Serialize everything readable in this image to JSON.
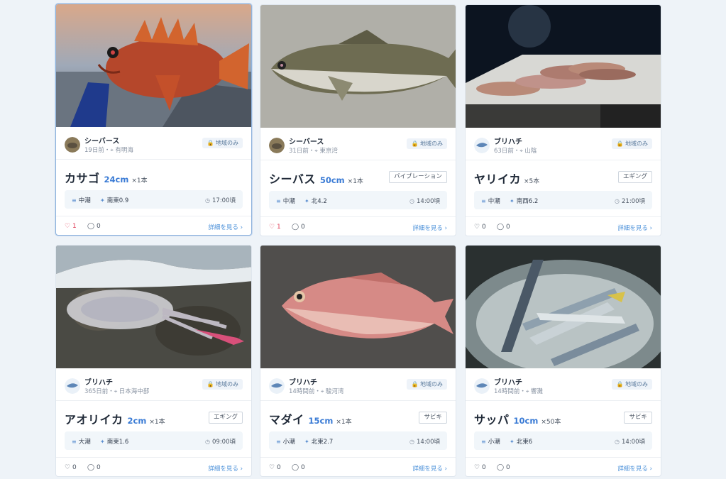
{
  "cards": [
    {
      "user": "シーバース",
      "meta": "19日前・",
      "location": "有明海",
      "badge": "地域のみ",
      "species": "カサゴ",
      "size": "24cm",
      "count": "×1本",
      "method": "",
      "tide": "中潮",
      "wind": "南東0.9",
      "time": "17:00頃",
      "likes": "1",
      "comments": "0",
      "detail": "詳細を見る ›",
      "photo_icon": "rockfish-photo"
    },
    {
      "user": "シーバース",
      "meta": "31日前・",
      "location": "東京湾",
      "badge": "地域のみ",
      "species": "シーバス",
      "size": "50cm",
      "count": "×1本",
      "method": "バイブレーション",
      "tide": "中潮",
      "wind": "北4.2",
      "time": "14:00頃",
      "likes": "1",
      "comments": "0",
      "detail": "詳細を見る ›",
      "photo_icon": "seabass-photo"
    },
    {
      "user": "ブリハチ",
      "meta": "63日前・",
      "location": "山陰",
      "badge": "地域のみ",
      "species": "ヤリイカ",
      "size": "",
      "count": "×5本",
      "method": "エギング",
      "tide": "中潮",
      "wind": "南西6.2",
      "time": "21:00頃",
      "likes": "0",
      "comments": "0",
      "detail": "詳細を見る ›",
      "photo_icon": "squid-photo"
    },
    {
      "user": "ブリハチ",
      "meta": "365日前・",
      "location": "日本海中部",
      "badge": "地域のみ",
      "species": "アオリイカ",
      "size": "2cm",
      "count": "×1本",
      "method": "エギング",
      "tide": "大潮",
      "wind": "南東1.6",
      "time": "09:00頃",
      "likes": "0",
      "comments": "0",
      "detail": "詳細を見る ›",
      "photo_icon": "cuttlefish-photo"
    },
    {
      "user": "ブリハチ",
      "meta": "14時間前・",
      "location": "駿河湾",
      "badge": "地域のみ",
      "species": "マダイ",
      "size": "15cm",
      "count": "×1本",
      "method": "サビキ",
      "tide": "小潮",
      "wind": "北東2.7",
      "time": "14:00頃",
      "likes": "0",
      "comments": "0",
      "detail": "詳細を見る ›",
      "photo_icon": "seabream-photo"
    },
    {
      "user": "ブリハチ",
      "meta": "14時間前・",
      "location": "響灘",
      "badge": "地域のみ",
      "species": "サッパ",
      "size": "10cm",
      "count": "×50本",
      "method": "サビキ",
      "tide": "小潮",
      "wind": "北東6",
      "time": "14:00頃",
      "likes": "0",
      "comments": "0",
      "detail": "詳細を見る ›",
      "photo_icon": "sardines-photo"
    }
  ],
  "colors": {
    "accent": "#3a7bd5",
    "like": "#e0405a",
    "link": "#4a90d9"
  }
}
